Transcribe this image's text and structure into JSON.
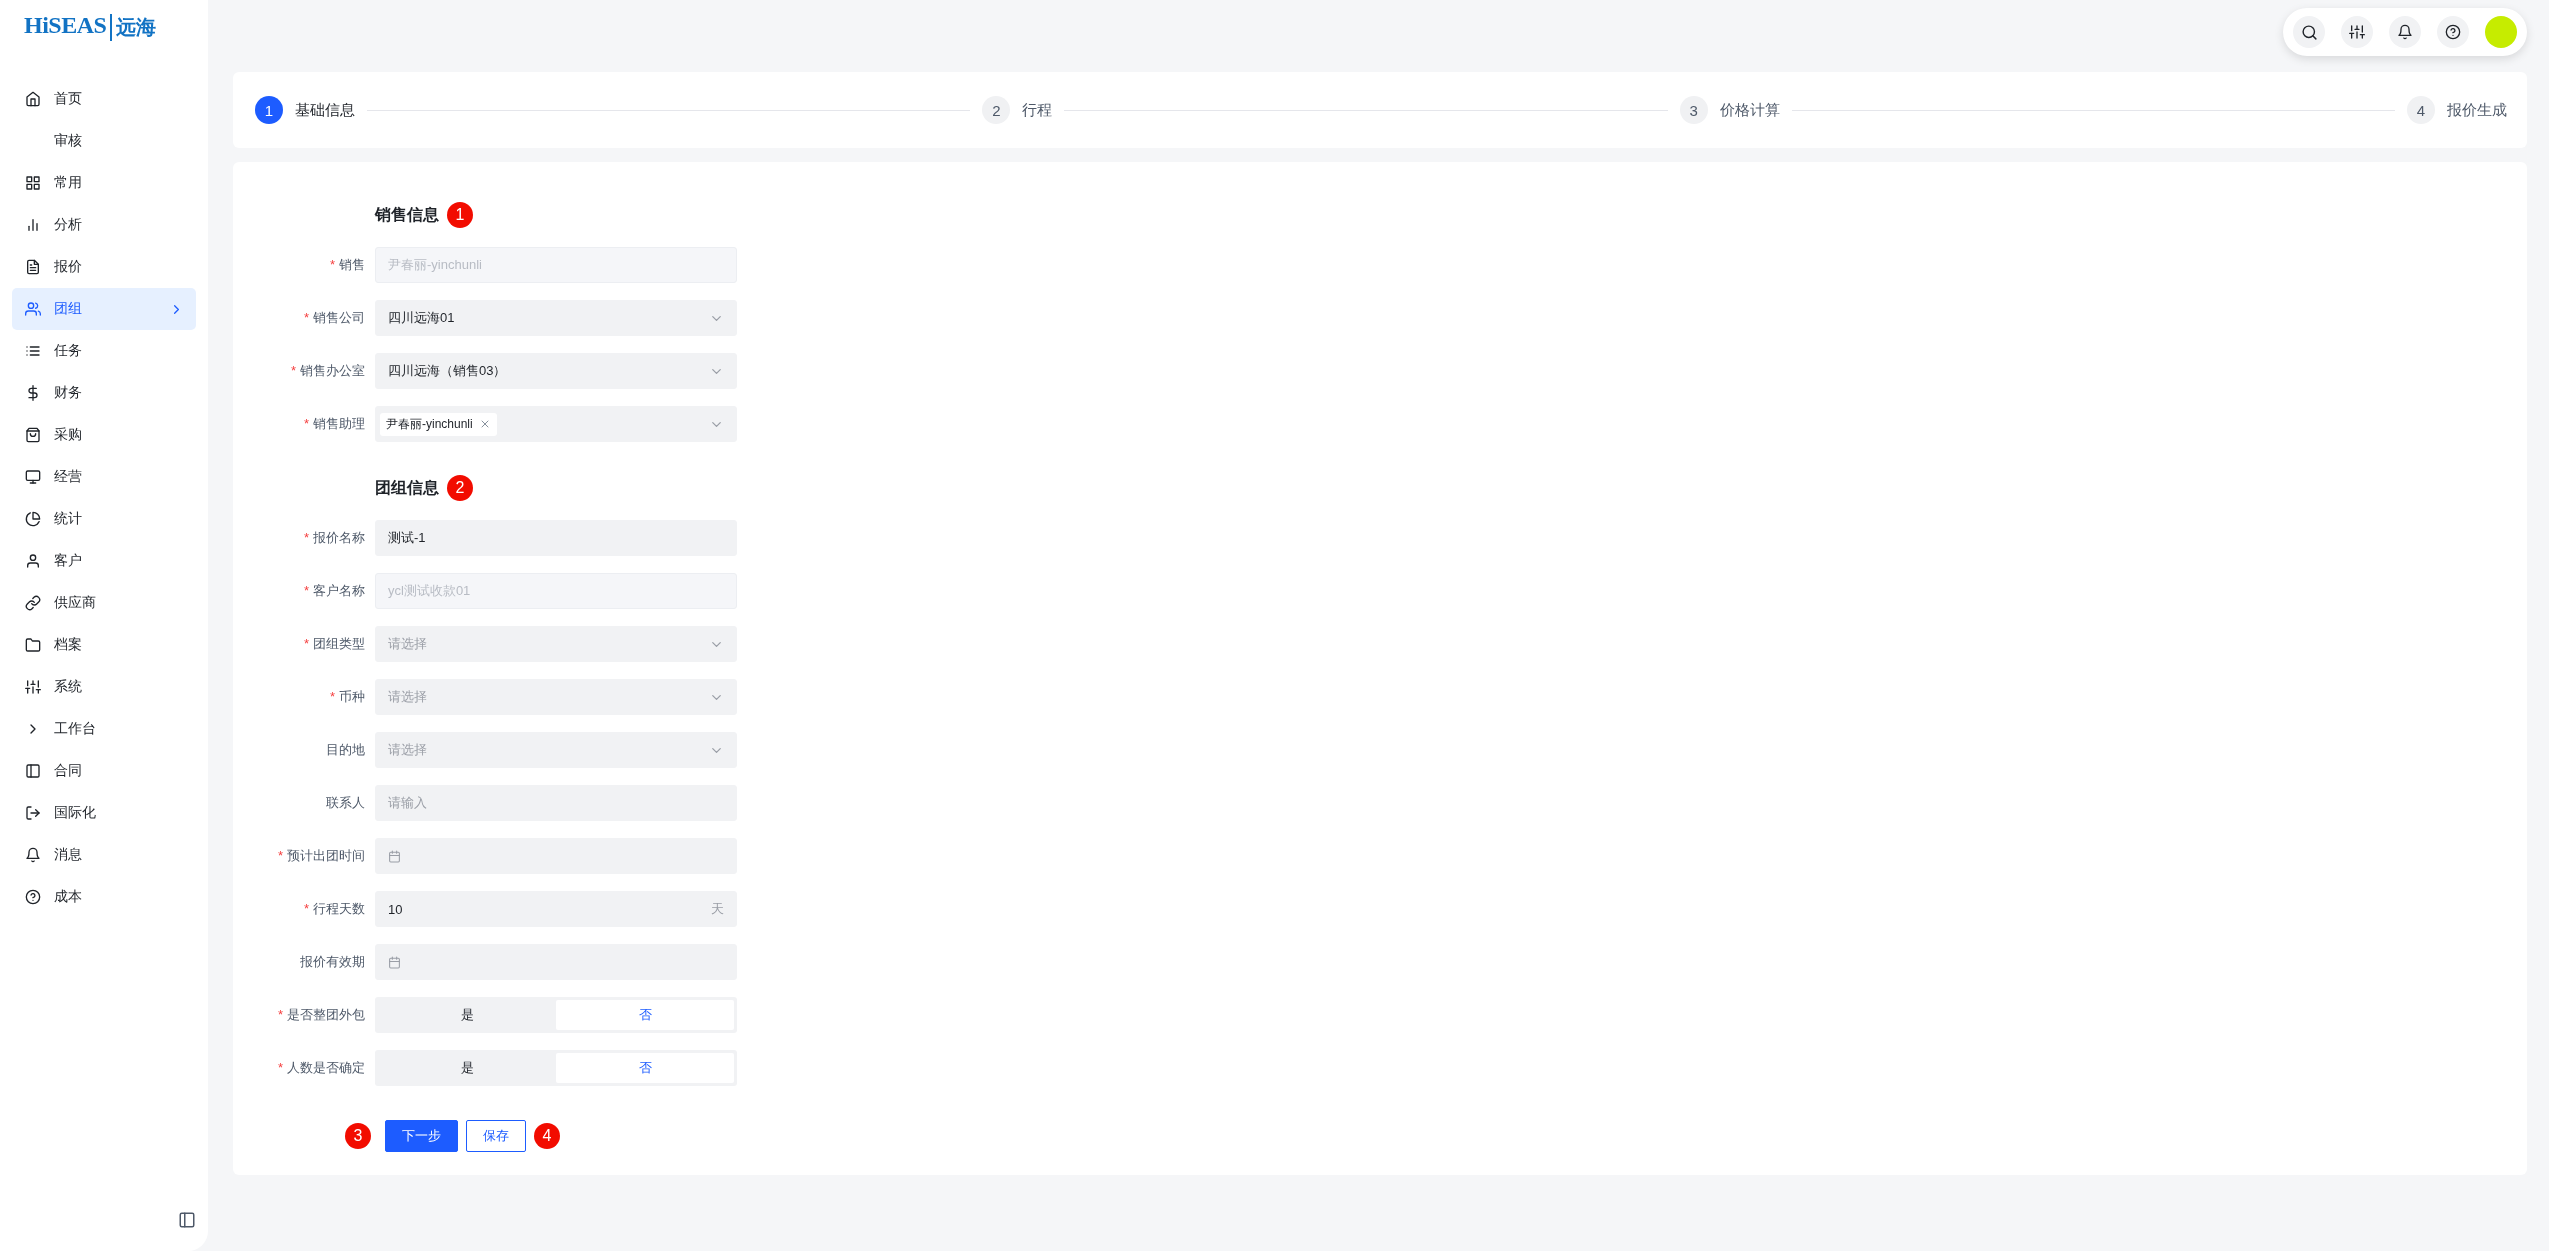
{
  "logo": {
    "latin": "HiSEAS",
    "chinese": "远海"
  },
  "sidebar": {
    "items": [
      {
        "label": "首页",
        "selected": false
      },
      {
        "label": "审核",
        "selected": false
      },
      {
        "label": "常用",
        "selected": false
      },
      {
        "label": "分析",
        "selected": false
      },
      {
        "label": "报价",
        "selected": false
      },
      {
        "label": "团组",
        "selected": true
      },
      {
        "label": "任务",
        "selected": false
      },
      {
        "label": "财务",
        "selected": false
      },
      {
        "label": "采购",
        "selected": false
      },
      {
        "label": "经营",
        "selected": false
      },
      {
        "label": "统计",
        "selected": false
      },
      {
        "label": "客户",
        "selected": false
      },
      {
        "label": "供应商",
        "selected": false
      },
      {
        "label": "档案",
        "selected": false
      },
      {
        "label": "系统",
        "selected": false
      },
      {
        "label": "工作台",
        "selected": false
      },
      {
        "label": "合同",
        "selected": false
      },
      {
        "label": "国际化",
        "selected": false
      },
      {
        "label": "消息",
        "selected": false
      },
      {
        "label": "成本",
        "selected": false
      }
    ]
  },
  "steps": [
    {
      "number": "1",
      "label": "基础信息",
      "selected": true
    },
    {
      "number": "2",
      "label": "行程",
      "selected": false
    },
    {
      "number": "3",
      "label": "价格计算",
      "selected": false
    },
    {
      "number": "4",
      "label": "报价生成",
      "selected": false
    }
  ],
  "sections": [
    {
      "title": "销售信息",
      "marker": "1",
      "fields": [
        {
          "kind": "input",
          "label": "销售",
          "required_mark": "*",
          "disabled": true,
          "value": "尹春丽-yinchunli"
        },
        {
          "kind": "select",
          "label": "销售公司",
          "required_mark": "*",
          "value": "四川远海01"
        },
        {
          "kind": "select",
          "label": "销售办公室",
          "required_mark": "*",
          "value": "四川远海（销售03）"
        },
        {
          "kind": "tags",
          "label": "销售助理",
          "required_mark": "*",
          "tags": [
            "尹春丽-yinchunli"
          ]
        }
      ]
    },
    {
      "title": "团组信息",
      "marker": "2",
      "fields": [
        {
          "kind": "input",
          "label": "报价名称",
          "required_mark": "*",
          "value": "测试-1"
        },
        {
          "kind": "input",
          "label": "客户名称",
          "required_mark": "*",
          "disabled": true,
          "value": "ycl测试收款01"
        },
        {
          "kind": "select",
          "label": "团组类型",
          "required_mark": "*",
          "placeholder": "请选择"
        },
        {
          "kind": "select",
          "label": "币种",
          "required_mark": "*",
          "placeholder": "请选择"
        },
        {
          "kind": "select",
          "label": "目的地",
          "placeholder": "请选择"
        },
        {
          "kind": "input",
          "label": "联系人",
          "placeholder": "请输入"
        },
        {
          "kind": "date",
          "label": "预计出团时间",
          "required_mark": "*"
        },
        {
          "kind": "unit",
          "label": "行程天数",
          "required_mark": "*",
          "value": "10",
          "unit": "天"
        },
        {
          "kind": "date",
          "label": "报价有效期"
        },
        {
          "kind": "toggle",
          "label": "是否整团外包",
          "required_mark": "*",
          "options": [
            {
              "label": "是",
              "selected": false
            },
            {
              "label": "否",
              "selected": true
            }
          ]
        },
        {
          "kind": "toggle",
          "label": "人数是否确定",
          "required_mark": "*",
          "options": [
            {
              "label": "是",
              "selected": false
            },
            {
              "label": "否",
              "selected": true
            }
          ]
        }
      ]
    }
  ],
  "actions": {
    "buttons": [
      {
        "label": "下一步",
        "kind": "primary",
        "marker": "3"
      },
      {
        "label": "保存",
        "kind": "secondary",
        "marker": "4"
      }
    ]
  }
}
